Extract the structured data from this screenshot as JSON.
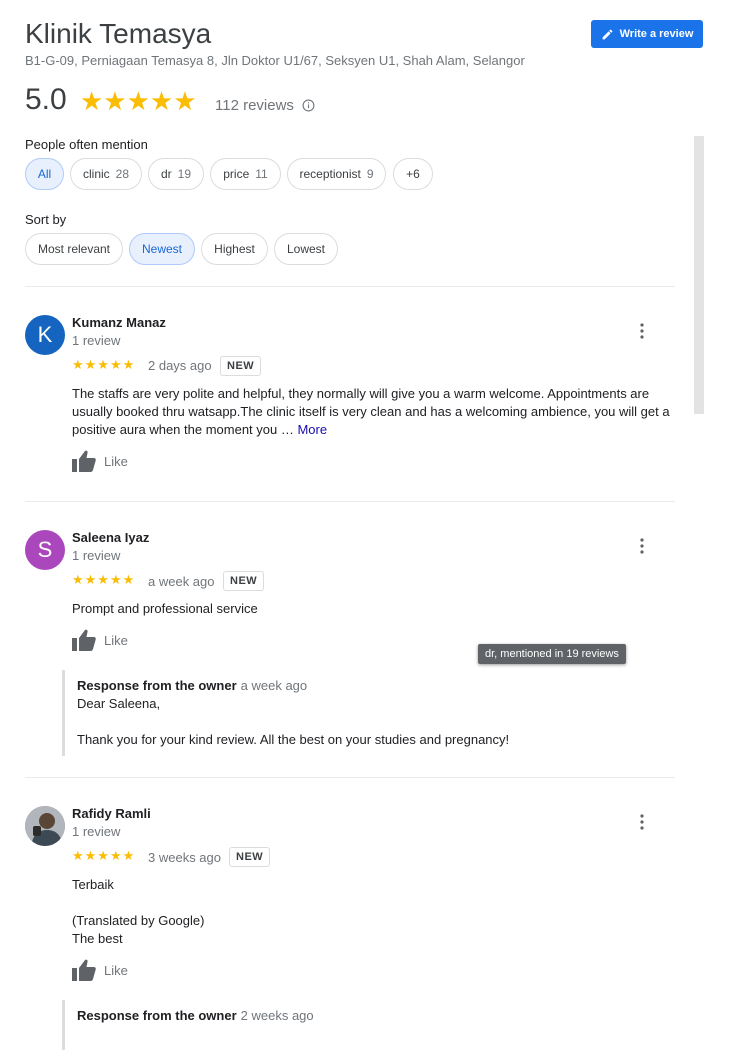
{
  "place": {
    "name": "Klinik Temasya",
    "address": "B1-G-09, Perniagaan Temasya 8, Jln Doktor U1/67, Seksyen U1, Shah Alam, Selangor",
    "rating": "5.0",
    "stars": "★★★★★",
    "review_count": "112 reviews",
    "write_review_label": "Write a review"
  },
  "mentions": {
    "label": "People often mention",
    "chips": [
      {
        "label": "All",
        "count": ""
      },
      {
        "label": "clinic",
        "count": "28"
      },
      {
        "label": "dr",
        "count": "19"
      },
      {
        "label": "price",
        "count": "11"
      },
      {
        "label": "receptionist",
        "count": "9"
      },
      {
        "label": "+6",
        "count": ""
      }
    ]
  },
  "sort": {
    "label": "Sort by",
    "options": [
      "Most relevant",
      "Newest",
      "Highest",
      "Lowest"
    ],
    "selected": "Newest"
  },
  "tooltip": "dr, mentioned in 19 reviews",
  "colors": {
    "accent": "#1a73e8",
    "star": "#fbbc04",
    "chip_active_bg": "#e8f0fe"
  },
  "reviews": [
    {
      "initial": "K",
      "avatar_color": "#1565c0",
      "name": "Kumanz Manaz",
      "meta": "1 review",
      "stars": "★★★★★",
      "when": "2 days ago",
      "badge": "NEW",
      "text": "The staffs are very polite and helpful, they normally will give you a warm welcome. Appointments are usually booked thru watsapp.The clinic itself is very clean and has a welcoming ambience, you will get a positive aura when the moment you …",
      "more": "More",
      "like": "Like"
    },
    {
      "initial": "S",
      "avatar_color": "#ab47bc",
      "name": "Saleena Iyaz",
      "meta": "1 review",
      "stars": "★★★★★",
      "when": "a week ago",
      "badge": "NEW",
      "text": "Prompt and professional service",
      "like": "Like",
      "owner": {
        "heading": "Response from the owner",
        "when": "a week ago",
        "greeting": "Dear Saleena,",
        "body": "Thank you for your kind review. All the best on your studies and pregnancy!"
      }
    },
    {
      "initial": "",
      "avatar_color": "#8d8d8d",
      "name": "Rafidy Ramli",
      "meta": "1 review",
      "stars": "★★★★★",
      "when": "3 weeks ago",
      "badge": "NEW",
      "text": "Terbaik",
      "translated_label": "(Translated by Google)",
      "translated_text": "The best",
      "like": "Like",
      "owner": {
        "heading": "Response from the owner",
        "when": "2 weeks ago"
      }
    }
  ]
}
